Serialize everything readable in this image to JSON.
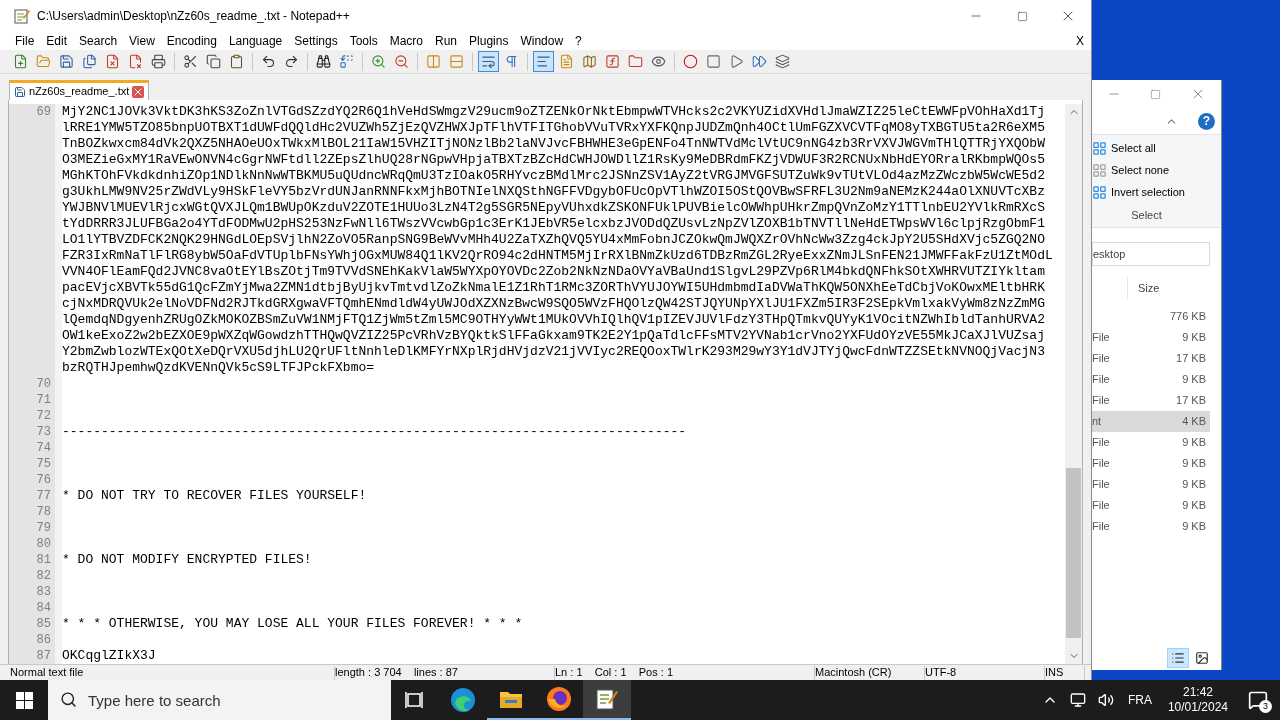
{
  "window": {
    "title": "C:\\Users\\admin\\Desktop\\nZz60s_readme_.txt - Notepad++"
  },
  "menu": [
    "File",
    "Edit",
    "Search",
    "View",
    "Encoding",
    "Language",
    "Settings",
    "Tools",
    "Macro",
    "Run",
    "Plugins",
    "Window",
    "?"
  ],
  "menu_close": "X",
  "toolbar": [
    {
      "kind": "new",
      "on": false
    },
    {
      "kind": "open",
      "on": false
    },
    {
      "kind": "save",
      "on": false
    },
    {
      "kind": "saveall",
      "on": false
    },
    {
      "kind": "close",
      "on": false
    },
    {
      "kind": "closeall",
      "on": false
    },
    {
      "kind": "print",
      "on": false
    },
    {
      "kind": "sep"
    },
    {
      "kind": "cut",
      "on": false
    },
    {
      "kind": "copy",
      "on": false
    },
    {
      "kind": "paste",
      "on": false
    },
    {
      "kind": "sep"
    },
    {
      "kind": "undo",
      "on": false
    },
    {
      "kind": "redo",
      "on": false
    },
    {
      "kind": "sep"
    },
    {
      "kind": "find",
      "on": false
    },
    {
      "kind": "replace",
      "on": false
    },
    {
      "kind": "sep"
    },
    {
      "kind": "zoomin",
      "on": false
    },
    {
      "kind": "zoomout",
      "on": false
    },
    {
      "kind": "sep"
    },
    {
      "kind": "syncv",
      "on": false
    },
    {
      "kind": "synch",
      "on": false
    },
    {
      "kind": "sep"
    },
    {
      "kind": "wrap",
      "on": true
    },
    {
      "kind": "allchars",
      "on": false
    },
    {
      "kind": "sep"
    },
    {
      "kind": "indent",
      "on": true
    },
    {
      "kind": "udl",
      "on": false
    },
    {
      "kind": "map",
      "on": false
    },
    {
      "kind": "function",
      "on": false
    },
    {
      "kind": "folder",
      "on": false
    },
    {
      "kind": "monitor",
      "on": false
    },
    {
      "kind": "sep"
    },
    {
      "kind": "record",
      "on": false
    },
    {
      "kind": "stop",
      "on": false
    },
    {
      "kind": "play",
      "on": false
    },
    {
      "kind": "playmulti",
      "on": false
    },
    {
      "kind": "savemacro",
      "on": false
    }
  ],
  "tabs": [
    {
      "label": "nZz60s_readme_.txt",
      "selected": true
    }
  ],
  "lines": [
    {
      "number": "69",
      "rows": [
        "MjY2NC1JOVk3VktDK3hKS3ZoZnlVTGdSZzdYQ2R6Q1hVeHdSWmgzV29ucm9oZTZENkOrNktEbmpwWTVHcks2c2VKYUZidXVHdlJmaWZIZ25leCtEWWFpVOhHaXd1Tj",
        "lRRE1YMW5TZO85bnpUOTBXT1dUWFdQQldHc2VUZWh5ZjEzQVZHWXJpTFlhVTFITGhobVVuTVRxYXFKQnpJUDZmQnh4OCtlUmFGZXVCVTFqMO8yTXBGTU5ta2R6eXM5",
        "TnBOZkwxcm84dVk2QXZ5NHAOeUOxTWkxMlBOL21IaW15VHZITjNONzlBb2laNVJvcFBHWHE3eGpENFo4TnNWTVdMclVtUC9nNG4zb3RrVXVJWGVmTHlQTTRjYXQObW",
        "O3MEZieGxMY1RaVEwONVN4cGgrNWFtdll2ZEpsZlhUQ28rNGpwVHpjaTBXTzBZcHdCWHJOWDllZ1RsKy9MeDBRdmFKZjVDWUF3R2RCNUxNbHdEYORralRKbmpWQOs5",
        "MGhKTOhFVkdkdnhiZOp1NDlkNnNwWTBKMU5uQUdncWRqQmU3TzIOakO5RHYvczBMdlMrc2JSNnZSV1AyZ2tVRGJMVGFSUTZuWk9vTUtVLOd4azMzZWczbW5WcWE5d2",
        "g3UkhLMW9NV25rZWdVLy9HSkFleVY5bzVrdUNJanRNNFkxMjhBOTNIelNXQSthNGFFVDgybOFUcOpVTlhWZOI5OStQOVBwSFRFL3U2Nm9aNEMzK244aOlXNUVTcXBz",
        "YWJBNVlMUEVlRjcxWGtQVXJLQm1BWUpOKzduV2ZOTE1HUUo3LzN4T2g5SGR5NEpyVUhxdkZSKONFUklPUVBielcOWWhpUHkrZmpQVnZoMzY1TTlnbEU2YVlkRmRXcS",
        "tYdDRRR3JLUFBGa2o4YTdFODMwU2pHS253NzFwNll6TWszVVcwbGp1c3ErK1JEbVR5elcxbzJVODdQZUsvLzNpZVlZOXB1bTNVTllNeHdETWpsWVl6clpjRzgObmF1",
        "LO1lYTBVZDFCK2NQK29HNGdLOEpSVjlhN2ZoVO5RanpSNG9BeWVvMHh4U2ZaTXZhQVQ5YU4xMmFobnJCZOkwQmJWQXZrOVhNcWw3Zzg4ckJpY2U5SHdXVjc5ZGQ2NO",
        "FZR3IxRmNaTlFlRG8ybW5OaFdVTUplbFNsYWhjOGxMUW84Q1lKV2QrRO94c2dHNTM5MjIrRXlBNmZkUzd6TDBzRmZGL2RyeExxZNmJLSnFEN21JMWFFakFzU1ZtMOdL",
        "VVN4OFlEamFQd2JVNC8vaOtEYlBsZOtjTm9TVVdSNEhKakVlaW5WYXpOYOVDc2Zob2NkNzNDaOVYaVBaUnd1SlgvL29PZVp6RlM4bkdQNFhkSOtXWHRVUTZIYkltam",
        "pacEVjcXBVTk55dG1QcFZmYjMwa2ZMN1dtbjByUjkvTmtvdlZoZkNmalE1Z1RhT1RMc3ZORThVYUJOYWI5UHdmbmdIaDVWaThKQW5ONXhEeTdCbjVoKOwxMEltbHRK",
        "cjNxMDRQVUk2elNoVDFNd2RJTkdGRXgwaVFTQmhENmdldW4yUWJOdXZXNzBwcW9SQO5WVzFHQOlzQW42STJQYUNpYXlJU1FXZm5IR3F2SEpkVmlxakVyWm8zNzZmMG",
        "lQemdqNDgyenhZRUgOZkMOKOZBSmZuVW1NMjFTQ1ZjWm5tZml5MC9OTHYyWWt1MUkOVVhIQlhQV1pIZEVJUVlFdzY3THpQTmkvQUYyK1VOcitNZWhIbldTanhURVA2",
        "OW1keExoZ2w2bEZXOE9pWXZqWGowdzhTTHQwQVZIZ25PcVRhVzBYQktkSlFFaGkxam9TK2E2Y1pQaTdlcFFsMTV2YVNab1crVno2YXFUdOYzVE55MkJCaXJlVUZsaj",
        "Y2bmZwblozWTExQOtXeDQrVXU5djhLU2QrUFltNnhleDlKMFYrNXplRjdHVjdzV21jVVIyc2REQOoxTWlrK293M29wY3Y1dVJTYjQwcFdnWTZZSEtkNVNOQjVacjN3",
        "bzRQTHJpemhwQzdKVENnQVk5cS9LTFJPckFXbmo="
      ]
    },
    {
      "number": "70"
    },
    {
      "number": "71"
    },
    {
      "number": "72"
    },
    {
      "number": "73",
      "rows": [
        "--------------------------------------------------------------------------------"
      ]
    },
    {
      "number": "74"
    },
    {
      "number": "75"
    },
    {
      "number": "76"
    },
    {
      "number": "77",
      "rows": [
        "* DO NOT TRY TO RECOVER FILES YOURSELF!"
      ]
    },
    {
      "number": "78"
    },
    {
      "number": "79"
    },
    {
      "number": "80"
    },
    {
      "number": "81",
      "rows": [
        "* DO NOT MODIFY ENCRYPTED FILES!"
      ]
    },
    {
      "number": "82"
    },
    {
      "number": "83"
    },
    {
      "number": "84"
    },
    {
      "number": "85",
      "rows": [
        "* * * OTHERWISE, YOU MAY LOSE ALL YOUR FILES FOREVER! * * *"
      ]
    },
    {
      "number": "86"
    },
    {
      "number": "87",
      "rows": [
        "OKCqglZIkX3J"
      ]
    }
  ],
  "status_bar": [
    "Normal text file",
    "length : 3 704    lines : 87",
    "Ln : 1    Col : 1    Pos : 1",
    "Macintosh (CR)",
    "UTF-8",
    "INS"
  ],
  "explorer": {
    "help": "?",
    "ribbon_items": [
      "Select all",
      "Select none",
      "Invert selection"
    ],
    "group_label": "Select",
    "address": "esktop",
    "column": "Size",
    "rows": [
      {
        "size": "776 KB",
        "selected": false
      },
      {
        "type": "File",
        "size": "9 KB",
        "selected": false
      },
      {
        "type": "File",
        "size": "17 KB",
        "selected": false
      },
      {
        "type": "File",
        "size": "9 KB",
        "selected": false
      },
      {
        "type": "File",
        "size": "17 KB",
        "selected": false
      },
      {
        "type": "nt",
        "size": "4 KB",
        "selected": true
      },
      {
        "type": "File",
        "size": "9 KB",
        "selected": false
      },
      {
        "type": "File",
        "size": "9 KB",
        "selected": false
      },
      {
        "type": "File",
        "size": "9 KB",
        "selected": false
      },
      {
        "type": "File",
        "size": "9 KB",
        "selected": false
      },
      {
        "type": "File",
        "size": "9 KB",
        "selected": false
      }
    ],
    "views": [
      {
        "kind": "details",
        "selected": true
      },
      {
        "kind": "large",
        "selected": false
      }
    ]
  },
  "taskbar": {
    "search": {
      "placeholder": "Type here to search"
    },
    "apps": [
      {
        "kind": "taskview",
        "running": false,
        "selected": false
      },
      {
        "kind": "edge",
        "running": false,
        "selected": false
      },
      {
        "kind": "explorer",
        "running": true,
        "selected": false
      },
      {
        "kind": "firefox",
        "running": true,
        "selected": false
      },
      {
        "kind": "notepad",
        "running": true,
        "selected": true
      }
    ],
    "language": "FRA",
    "time": "21:42",
    "date": "10/01/2024",
    "notifications": "3"
  }
}
